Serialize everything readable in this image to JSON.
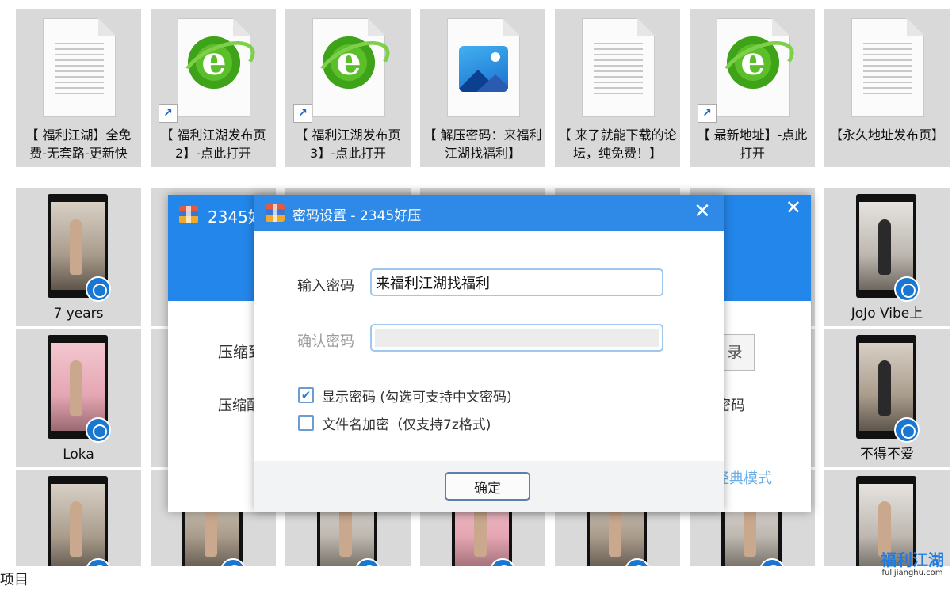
{
  "files_row1": [
    {
      "label": "【 福利江湖】全免费-无套路-更新快",
      "icon": "text-document-icon"
    },
    {
      "label": "【 福利江湖发布页2】-点此打开",
      "icon": "browser-shortcut-icon"
    },
    {
      "label": "【 福利江湖发布页3】-点此打开",
      "icon": "browser-shortcut-icon"
    },
    {
      "label": "【 解压密码：来福利江湖找福利】",
      "icon": "image-file-icon"
    },
    {
      "label": "【 来了就能下载的论坛，纯免费！】",
      "icon": "text-document-icon"
    },
    {
      "label": "【 最新地址】-点此打开",
      "icon": "browser-shortcut-icon"
    },
    {
      "label": "【永久地址发布页】",
      "icon": "text-document-icon"
    }
  ],
  "videos": [
    {
      "label": "7 years"
    },
    {
      "label": "JoJo Vibe上"
    },
    {
      "label": "Loka"
    },
    {
      "label": "不得不爱"
    }
  ],
  "back_dialog": {
    "title": "2345好",
    "text1": "压缩到",
    "text2": "压缩配",
    "btn": "录",
    "text4": "密码",
    "link": "经典模式"
  },
  "dialog": {
    "title": "密码设置 - 2345好压",
    "password_label": "输入密码",
    "password_value": "来福利江湖找福利",
    "confirm_label": "确认密码",
    "confirm_value": "",
    "show_password_label": "显示密码 (勾选可支持中文密码)",
    "show_password_checked": true,
    "encrypt_names_label": "文件名加密（仅支持7z格式)",
    "encrypt_names_checked": false,
    "ok_label": "确定",
    "close_glyph": "✕"
  },
  "status_bar": {
    "text": "项目"
  },
  "watermark": {
    "line1": "福利江湖",
    "line2": "fulijianghu.com"
  },
  "colors": {
    "accent": "#2e8ae6",
    "tile_bg": "#d9d9d9"
  }
}
